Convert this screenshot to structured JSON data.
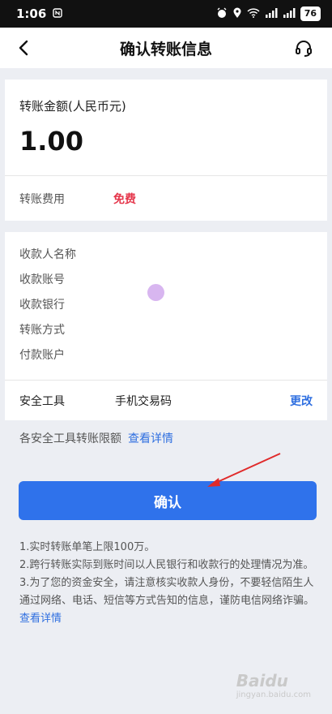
{
  "status_bar": {
    "time": "1:06",
    "battery": "76"
  },
  "nav": {
    "title": "确认转账信息"
  },
  "amount": {
    "label": "转账金额(人民币元)",
    "value": "1.00"
  },
  "fee": {
    "label": "转账费用",
    "value": "免费"
  },
  "payee": {
    "rows": [
      "收款人名称",
      "收款账号",
      "收款银行",
      "转账方式",
      "付款账户"
    ]
  },
  "security": {
    "label": "安全工具",
    "value": "手机交易码",
    "change_label": "更改"
  },
  "limit": {
    "text": "各安全工具转账限额",
    "link": "查看详情"
  },
  "confirm": {
    "label": "确认"
  },
  "notes": {
    "line1": "1.实时转账单笔上限100万。",
    "line2": "2.跨行转账实际到账时间以人民银行和收款行的处理情况为准。",
    "line3": "3.为了您的资金安全，请注意核实收款人身份，不要轻信陌生人通过网络、电话、短信等方式告知的信息，谨防电信网络诈骗。",
    "link": "查看详情"
  },
  "watermark": {
    "brand": "Baidu",
    "sub": "jingyan.baidu.com"
  },
  "colors": {
    "accent": "#2f72eb",
    "link": "#2f6fe0",
    "fee": "#e5364b",
    "annotation_arrow": "#e02a2a"
  }
}
